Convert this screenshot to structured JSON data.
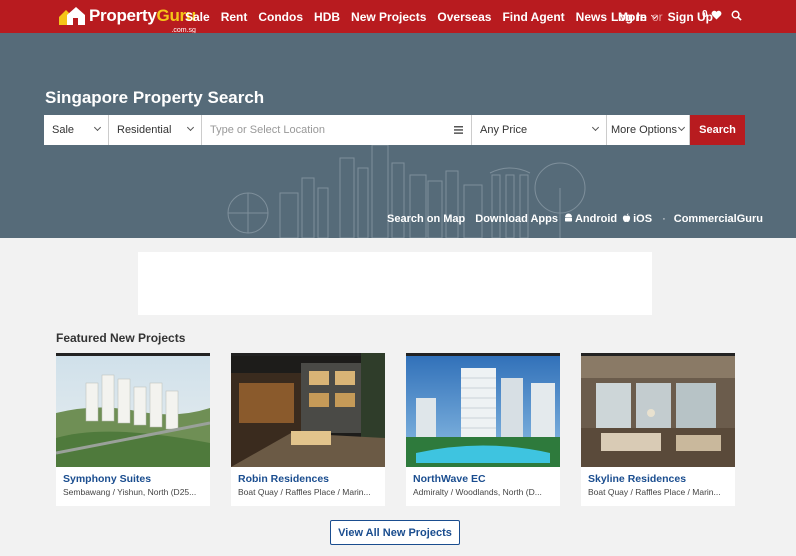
{
  "brand": {
    "logo_part1": "Property",
    "logo_part2": "Guru",
    "logo_sub": ".com.sg",
    "primary_color": "#b81b1f",
    "accent_color": "#f5c518"
  },
  "nav": {
    "items": [
      "Sale",
      "Rent",
      "Condos",
      "HDB",
      "New Projects",
      "Overseas",
      "Find Agent",
      "News"
    ],
    "more_label": "More"
  },
  "auth": {
    "login_label": "Log In",
    "or_label": "or",
    "signup_label": "Sign Up",
    "favourites_count": "0"
  },
  "hero": {
    "title": "Singapore Property Search",
    "listing_type": "Sale",
    "property_type": "Residential",
    "location_placeholder": "Type or Select Location",
    "price": "Any Price",
    "more_options": "More Options",
    "search_button": "Search",
    "links": {
      "search_on_map": "Search on Map",
      "download_apps": "Download Apps",
      "android": "Android",
      "ios": "iOS",
      "commercial": "CommercialGuru"
    },
    "background_color": "#566b79"
  },
  "featured": {
    "title": "Featured New Projects",
    "projects": [
      {
        "name": "Symphony Suites",
        "location": "Sembawang / Yishun, North (D25..."
      },
      {
        "name": "Robin Residences",
        "location": "Boat Quay / Raffles Place / Marin..."
      },
      {
        "name": "NorthWave EC",
        "location": "Admiralty / Woodlands, North (D..."
      },
      {
        "name": "Skyline Residences",
        "location": "Boat Quay / Raffles Place / Marin..."
      }
    ],
    "view_all_label": "View All New Projects",
    "link_color": "#1a4d8f"
  }
}
